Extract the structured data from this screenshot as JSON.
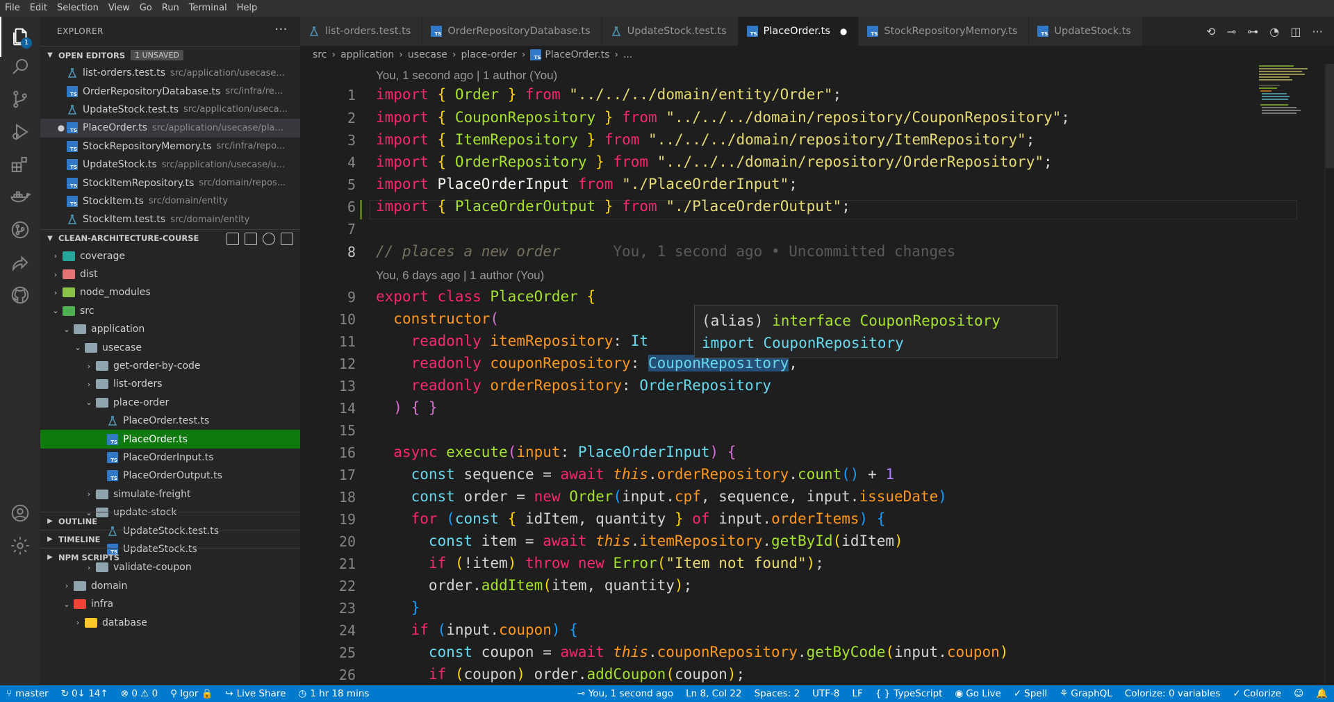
{
  "menu": [
    "File",
    "Edit",
    "Selection",
    "View",
    "Go",
    "Run",
    "Terminal",
    "Help"
  ],
  "activity": {
    "explorer_badge": "1"
  },
  "sidebar": {
    "title": "EXPLORER",
    "more": "···",
    "open_editors": {
      "label": "OPEN EDITORS",
      "unsaved": "1 UNSAVED",
      "items": [
        {
          "name": "list-orders.test.ts",
          "path": "src/application/usecase...",
          "kind": "test"
        },
        {
          "name": "OrderRepositoryDatabase.ts",
          "path": "src/infra/re...",
          "kind": "ts"
        },
        {
          "name": "UpdateStock.test.ts",
          "path": "src/application/useca...",
          "kind": "test"
        },
        {
          "name": "PlaceOrder.ts",
          "path": "src/application/usecase/pla...",
          "kind": "ts",
          "modified": true
        },
        {
          "name": "StockRepositoryMemory.ts",
          "path": "src/infra/repo...",
          "kind": "ts"
        },
        {
          "name": "UpdateStock.ts",
          "path": "src/application/usecase/u...",
          "kind": "ts"
        },
        {
          "name": "StockItemRepository.ts",
          "path": "src/domain/repos...",
          "kind": "ts"
        },
        {
          "name": "StockItem.ts",
          "path": "src/domain/entity",
          "kind": "ts"
        },
        {
          "name": "StockItem.test.ts",
          "path": "src/domain/entity",
          "kind": "test"
        }
      ]
    },
    "project": {
      "label": "CLEAN-ARCHITECTURE-COURSE",
      "tree": [
        {
          "label": "coverage",
          "depth": 0,
          "type": "folder",
          "open": false,
          "color": "#26a69a"
        },
        {
          "label": "dist",
          "depth": 0,
          "type": "folder",
          "open": false,
          "color": "#e57373"
        },
        {
          "label": "node_modules",
          "depth": 0,
          "type": "folder",
          "open": false,
          "color": "#8bc34a"
        },
        {
          "label": "src",
          "depth": 0,
          "type": "folder",
          "open": true,
          "color": "#4caf50"
        },
        {
          "label": "application",
          "depth": 1,
          "type": "folder",
          "open": true,
          "color": "#90a4ae"
        },
        {
          "label": "usecase",
          "depth": 2,
          "type": "folder",
          "open": true,
          "color": "#90a4ae"
        },
        {
          "label": "get-order-by-code",
          "depth": 3,
          "type": "folder",
          "open": false,
          "color": "#90a4ae"
        },
        {
          "label": "list-orders",
          "depth": 3,
          "type": "folder",
          "open": false,
          "color": "#90a4ae"
        },
        {
          "label": "place-order",
          "depth": 3,
          "type": "folder",
          "open": true,
          "color": "#90a4ae"
        },
        {
          "label": "PlaceOrder.test.ts",
          "depth": 4,
          "type": "test"
        },
        {
          "label": "PlaceOrder.ts",
          "depth": 4,
          "type": "ts",
          "selected": true
        },
        {
          "label": "PlaceOrderInput.ts",
          "depth": 4,
          "type": "ts"
        },
        {
          "label": "PlaceOrderOutput.ts",
          "depth": 4,
          "type": "ts"
        },
        {
          "label": "simulate-freight",
          "depth": 3,
          "type": "folder",
          "open": false,
          "color": "#90a4ae"
        },
        {
          "label": "update-stock",
          "depth": 3,
          "type": "folder",
          "open": true,
          "color": "#90a4ae"
        },
        {
          "label": "UpdateStock.test.ts",
          "depth": 4,
          "type": "test"
        },
        {
          "label": "UpdateStock.ts",
          "depth": 4,
          "type": "ts"
        },
        {
          "label": "validate-coupon",
          "depth": 3,
          "type": "folder",
          "open": false,
          "color": "#90a4ae"
        },
        {
          "label": "domain",
          "depth": 1,
          "type": "folder",
          "open": false,
          "color": "#90a4ae"
        },
        {
          "label": "infra",
          "depth": 1,
          "type": "folder",
          "open": true,
          "color": "#f44336"
        },
        {
          "label": "database",
          "depth": 2,
          "type": "folder",
          "open": false,
          "color": "#ffca28"
        }
      ]
    },
    "outline": "OUTLINE",
    "timeline": "TIMELINE",
    "npm": "NPM SCRIPTS"
  },
  "tabs": [
    {
      "label": "list-orders.test.ts",
      "kind": "test"
    },
    {
      "label": "OrderRepositoryDatabase.ts",
      "kind": "ts"
    },
    {
      "label": "UpdateStock.test.ts",
      "kind": "test"
    },
    {
      "label": "PlaceOrder.ts",
      "kind": "ts",
      "active": true,
      "modified": true
    },
    {
      "label": "StockRepositoryMemory.ts",
      "kind": "ts"
    },
    {
      "label": "UpdateStock.ts",
      "kind": "ts"
    }
  ],
  "breadcrumb": [
    "src",
    "application",
    "usecase",
    "place-order",
    "PlaceOrder.ts",
    "..."
  ],
  "editor": {
    "codelens_top": "You, 1 second ago | 1 author (You)",
    "codelens_class": "You, 6 days ago | 1 author (You)",
    "line_numbers": [
      "1",
      "2",
      "3",
      "4",
      "5",
      "6",
      "7",
      "8",
      "9",
      "10",
      "11",
      "12",
      "13",
      "14",
      "15",
      "16",
      "17",
      "18",
      "19",
      "20",
      "21",
      "22",
      "23",
      "24",
      "25",
      "26"
    ],
    "current_line": "8",
    "blame": "You, 1 second ago • Uncommitted changes",
    "comment": "// places a new order",
    "hover": {
      "line1_a": "(alias) ",
      "line1_b": "interface",
      "line1_c": " CouponRepository",
      "line2_a": "import",
      "line2_b": " CouponRepository"
    }
  },
  "statusbar": {
    "branch": "master",
    "sync": "0↓ 14↑",
    "problems": "⊗ 0 ⚠ 0",
    "user": "Igor",
    "liveshare": "Live Share",
    "timer": "1 hr 18 mins",
    "blame": "You, 1 second ago",
    "position": "Ln 8, Col 22",
    "spaces": "Spaces: 2",
    "encoding": "UTF-8",
    "eol": "LF",
    "language": "TypeScript",
    "golive": "Go Live",
    "spell": "Spell",
    "graphql": "GraphQL",
    "colorize_vars": "Colorize: 0 variables",
    "colorize": "Colorize"
  }
}
